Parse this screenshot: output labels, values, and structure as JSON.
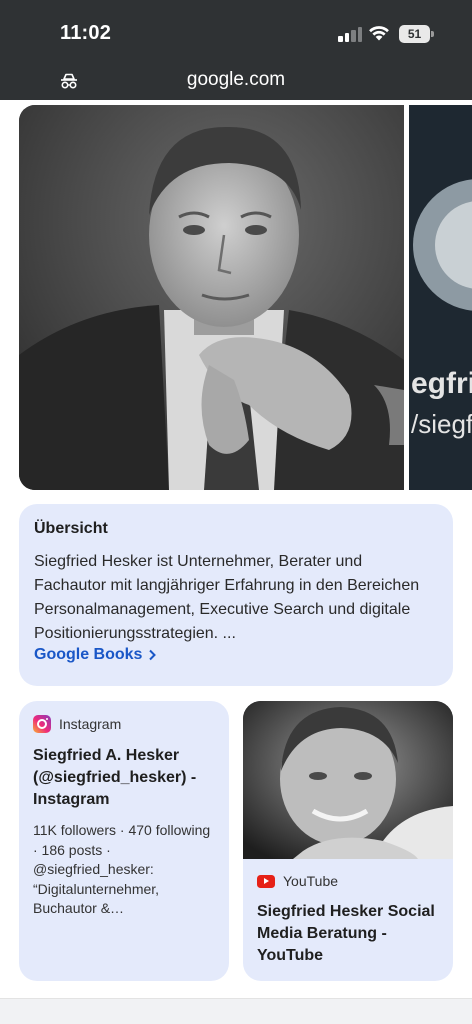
{
  "status_bar": {
    "time": "11:02",
    "battery": "51"
  },
  "browser": {
    "url": "google.com"
  },
  "hero": {
    "side_text_line1": "egfri",
    "side_text_line2": "/siegf"
  },
  "overview": {
    "title": "Übersicht",
    "body": "Siegfried Hesker ist Unternehmer, Berater und Fachautor mit langjähriger Erfahrung in den Bereichen Personalmanagement, Executive Search und digitale Positionierungsstrategien. ...",
    "link": "Google Books"
  },
  "cards": [
    {
      "source": "Instagram",
      "icon": "instagram-icon",
      "title": "Siegfried A. Hesker (@siegfried_hesker) - Instagram",
      "snippet": "11K followers · 470 following · 186 posts · @siegfried_hesker: “Digitalunternehmer, Buchautor &…"
    },
    {
      "source": "YouTube",
      "icon": "youtube-icon",
      "title": "Siegfried Hesker Social Media Beratung - YouTube"
    }
  ],
  "colors": {
    "chrome": "#2f3234",
    "card": "#e4eafb",
    "link": "#1a57c7"
  }
}
